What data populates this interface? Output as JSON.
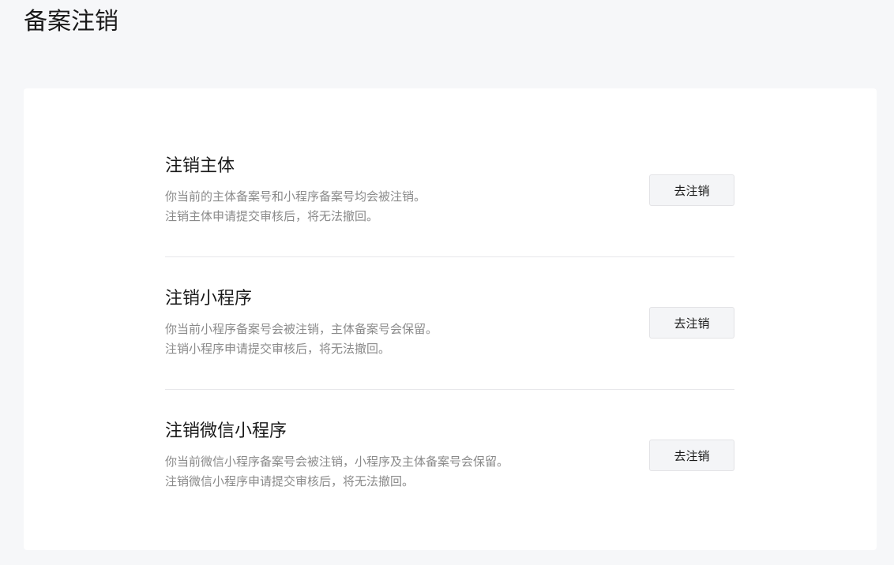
{
  "page": {
    "title": "备案注销"
  },
  "options": [
    {
      "title": "注销主体",
      "desc_line1": "你当前的主体备案号和小程序备案号均会被注销。",
      "desc_line2": "注销主体申请提交审核后，将无法撤回。",
      "button_label": "去注销"
    },
    {
      "title": "注销小程序",
      "desc_line1": "你当前小程序备案号会被注销，主体备案号会保留。",
      "desc_line2": "注销小程序申请提交审核后，将无法撤回。",
      "button_label": "去注销"
    },
    {
      "title": "注销微信小程序",
      "desc_line1": "你当前微信小程序备案号会被注销，小程序及主体备案号会保留。",
      "desc_line2": "注销微信小程序申请提交审核后，将无法撤回。",
      "button_label": "去注销"
    }
  ],
  "colors": {
    "background": "#f6f7f9",
    "card": "#ffffff",
    "title_text": "#1a1a1a",
    "desc_text": "#8a8a8a",
    "divider": "#e7e7eb",
    "button_bg": "#f4f5f7",
    "button_border": "#e3e3e6"
  }
}
